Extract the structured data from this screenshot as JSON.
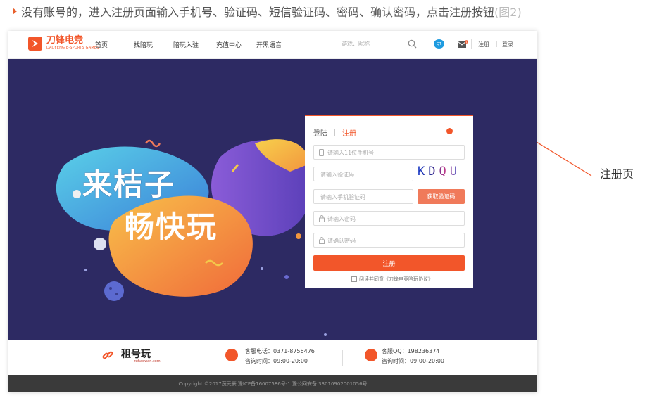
{
  "caption": {
    "text": "没有账号的，进入注册页面输入手机号、验证码、短信验证码、密码、确认密码，点击注册按钮",
    "fig": "(图2)"
  },
  "logo": {
    "title": "刀锋电竞",
    "subtitle": "DAOFENG E-SPORTS GAMES"
  },
  "nav": {
    "items": [
      "首页",
      "找陪玩",
      "陪玩入驻",
      "充值中心",
      "开黑语音"
    ],
    "search_placeholder": "游戏、昵称",
    "register": "注册",
    "login": "登录",
    "qq_label": "QT",
    "mail_badge": "1"
  },
  "hero": {
    "slogan1": "来桔子",
    "slogan2": "畅快玩"
  },
  "form": {
    "tab_login": "登陆",
    "tab_sep": "|",
    "tab_register": "注册",
    "phone_placeholder": "请输入11位手机号",
    "code_placeholder": "请输入验证码",
    "captcha": "KDQU",
    "sms_placeholder": "请输入手机验证码",
    "sms_button": "获取验证码",
    "password_placeholder": "请输入密码",
    "confirm_placeholder": "请确认密码",
    "submit": "注册",
    "agreement": "阅读并同意《刀锋电竞陪玩协议》"
  },
  "footer": {
    "brand": "租号玩",
    "brand_sub": "zuhaowan.com",
    "phone_line": "客服电话：0371-8756476",
    "phone_hours": "咨询时间：09:00-20:00",
    "qq_line": "客服QQ：198236374",
    "qq_hours": "咨询时间：09:00-20:00",
    "copyright": "Copyright ©2017茂元豪 豫ICP备16007586号-1 豫公网安备 33010902001056号"
  },
  "annotation": {
    "label": "注册页"
  },
  "colors": {
    "accent": "#f2562a",
    "hero_bg": "#2d2a63",
    "footer_dark": "#3a3a3a"
  }
}
